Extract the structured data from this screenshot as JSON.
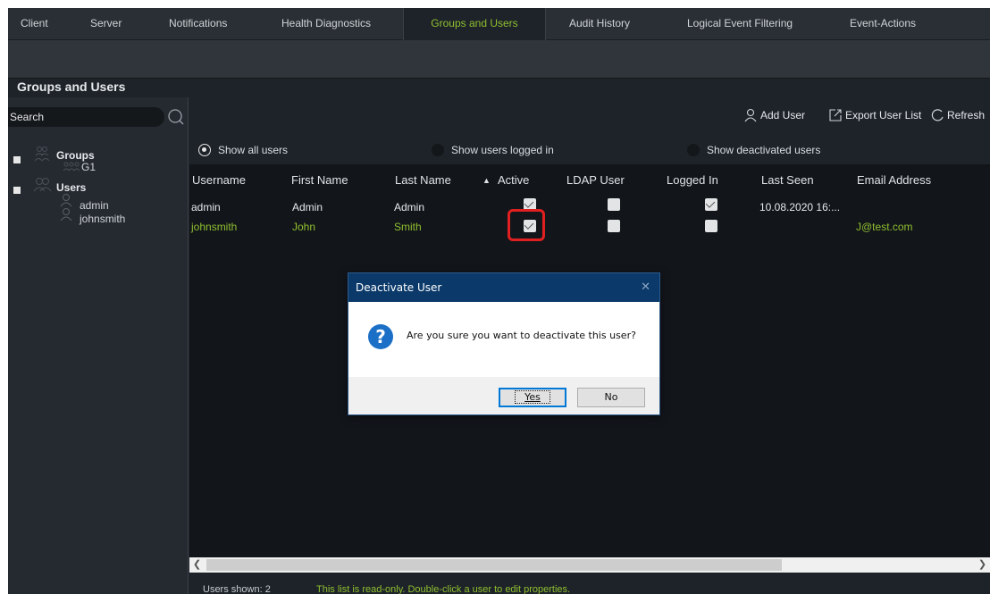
{
  "tabs": [
    {
      "label": "Client",
      "active": false
    },
    {
      "label": "Server",
      "active": false
    },
    {
      "label": "Notifications",
      "active": false
    },
    {
      "label": "Health Diagnostics",
      "active": false
    },
    {
      "label": "Groups and Users",
      "active": true
    },
    {
      "label": "Audit History",
      "active": false
    },
    {
      "label": "Logical Event Filtering",
      "active": false
    },
    {
      "label": "Event-Actions",
      "active": false
    }
  ],
  "panel_title": "Groups and Users",
  "search": {
    "placeholder": "Search",
    "value": ""
  },
  "tree": {
    "groups_label": "Groups",
    "groups": [
      "G1"
    ],
    "users_label": "Users",
    "users": [
      "admin",
      "johnsmith"
    ]
  },
  "toolbar": {
    "add_user": "Add User",
    "export": "Export User List",
    "refresh": "Refresh"
  },
  "filters": [
    {
      "label": "Show all users",
      "selected": true
    },
    {
      "label": "Show users logged in",
      "selected": false
    },
    {
      "label": "Show deactivated users",
      "selected": false
    }
  ],
  "columns": [
    "Username",
    "First Name",
    "Last Name",
    "Active",
    "LDAP User",
    "Logged In",
    "Last Seen",
    "Email Address"
  ],
  "sort_indicator": "▲",
  "rows": [
    {
      "username": "admin",
      "first": "Admin",
      "last": "Admin",
      "active": true,
      "ldap": false,
      "logged_in": true,
      "last_seen": "10.08.2020 16:...",
      "email": ""
    },
    {
      "username": "johnsmith",
      "first": "John",
      "last": "Smith",
      "active": true,
      "ldap": false,
      "logged_in": false,
      "last_seen": "",
      "email": "J@test.com"
    }
  ],
  "status": {
    "users_shown": "Users shown: 2",
    "hint": "This list is read-only. Double-click a user to edit properties."
  },
  "dialog": {
    "title": "Deactivate User",
    "message": "Are you sure you want to deactivate this user?",
    "yes": "Yes",
    "no": "No",
    "close": "✕"
  },
  "colors": {
    "accent_green": "#8fbf2f",
    "background": "#1e2329",
    "dialog_title": "#0b3a6a",
    "highlight": "#e02020"
  }
}
